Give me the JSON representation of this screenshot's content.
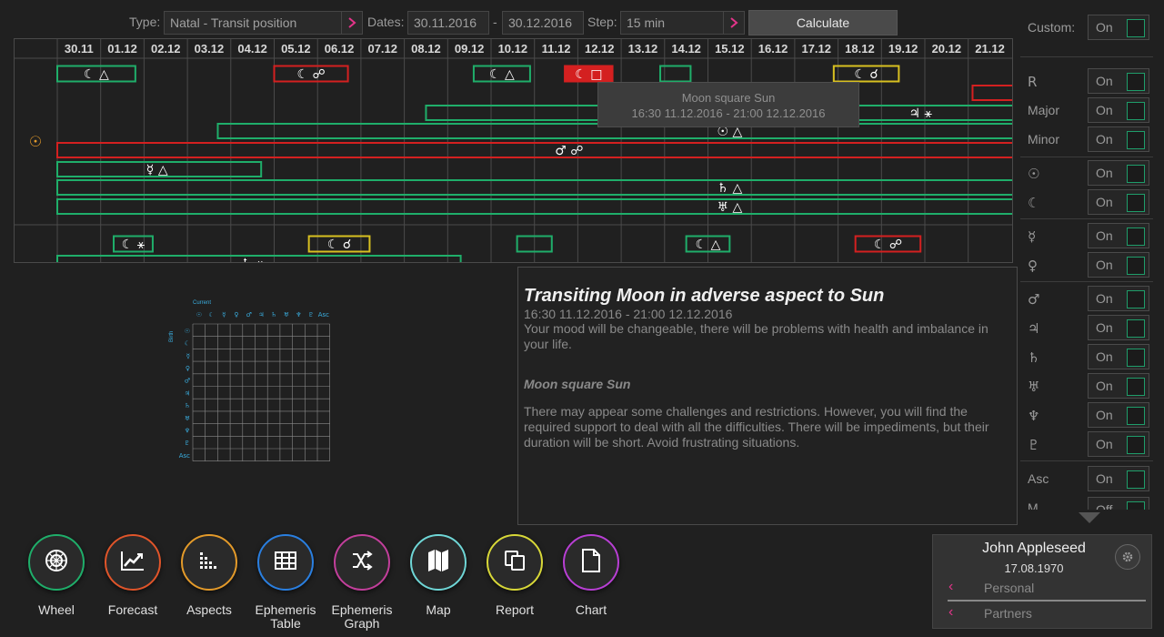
{
  "toolbar": {
    "type_label": "Type:",
    "type_value": "Natal - Transit position",
    "dates_label": "Dates:",
    "date_from": "30.11.2016",
    "date_sep": "-",
    "date_to": "30.12.2016",
    "step_label": "Step:",
    "step_value": "15 min",
    "calculate_label": "Calculate"
  },
  "grid": {
    "dates": [
      "30.11",
      "01.12",
      "02.12",
      "03.12",
      "04.12",
      "05.12",
      "06.12",
      "07.12",
      "08.12",
      "09.12",
      "10.12",
      "11.12",
      "12.12",
      "13.12",
      "14.12",
      "15.12",
      "16.12",
      "17.12",
      "18.12",
      "19.12",
      "20.12",
      "21.12"
    ],
    "natal_planet_glyph": "☉",
    "bars": [
      {
        "row": 0,
        "start": 0,
        "end": 1.8,
        "color": "green",
        "label": "☾ △"
      },
      {
        "row": 0,
        "start": 5.0,
        "end": 6.7,
        "color": "red",
        "label": "☾ ☍"
      },
      {
        "row": 0,
        "start": 9.6,
        "end": 10.9,
        "color": "green",
        "label": "☾ △"
      },
      {
        "row": 0,
        "start": 11.7,
        "end": 12.8,
        "color": "red-fill",
        "label": "☾ □"
      },
      {
        "row": 0,
        "start": 13.9,
        "end": 14.6,
        "color": "green",
        "label": ""
      },
      {
        "row": 0,
        "start": 17.9,
        "end": 19.4,
        "color": "yellow",
        "label": "☾ ☌"
      },
      {
        "row": 1,
        "start": 21.1,
        "end": 22.5,
        "color": "red",
        "label": ""
      },
      {
        "row": 2,
        "start": 8.5,
        "end": 22.5,
        "color": "green",
        "label": "♃ ⚹"
      },
      {
        "row": 3,
        "start": 3.7,
        "end": 22.5,
        "color": "green",
        "label": "☉ △"
      },
      {
        "row": 4,
        "start": 0,
        "end": 22.5,
        "color": "red",
        "label": "♂ ☍"
      },
      {
        "row": 5,
        "start": 0,
        "end": 4.7,
        "color": "green",
        "label": "☿ △"
      },
      {
        "row": 6,
        "start": 0,
        "end": 22.5,
        "color": "green",
        "label": "♄ △"
      },
      {
        "row": 7,
        "start": 0,
        "end": 22.5,
        "color": "green",
        "label": "♅ △"
      },
      {
        "row": 8,
        "start": 1.3,
        "end": 2.2,
        "color": "green",
        "label": "☾ ⚹"
      },
      {
        "row": 8,
        "start": 5.8,
        "end": 7.2,
        "color": "yellow",
        "label": "☾ ☌"
      },
      {
        "row": 8,
        "start": 10.6,
        "end": 11.4,
        "color": "green",
        "label": ""
      },
      {
        "row": 8,
        "start": 14.5,
        "end": 15.5,
        "color": "green",
        "label": "☾ △"
      },
      {
        "row": 8,
        "start": 18.4,
        "end": 19.9,
        "color": "red",
        "label": "☾ ☍"
      },
      {
        "row": 9,
        "start": 0,
        "end": 9.3,
        "color": "green",
        "label": "♄ ⚹"
      }
    ]
  },
  "tooltip": {
    "title": "Moon square Sun",
    "range": "16:30 11.12.2016 - 21:00 12.12.2016"
  },
  "right_panel": {
    "rows": [
      {
        "label": "Custom:",
        "value": "On"
      },
      {
        "label": "R",
        "value": "On"
      },
      {
        "label": "Major",
        "value": "On"
      },
      {
        "label": "Minor",
        "value": "On"
      },
      {
        "label": "☉",
        "value": "On"
      },
      {
        "label": "☾",
        "value": "On"
      },
      {
        "label": "☿",
        "value": "On"
      },
      {
        "label": "♀",
        "value": "On"
      },
      {
        "label": "♂",
        "value": "On"
      },
      {
        "label": "♃",
        "value": "On"
      },
      {
        "label": "♄",
        "value": "On"
      },
      {
        "label": "♅",
        "value": "On"
      },
      {
        "label": "♆",
        "value": "On"
      },
      {
        "label": "♇",
        "value": "On"
      },
      {
        "label": "Asc",
        "value": "On"
      },
      {
        "label": "M",
        "value": "Off"
      }
    ]
  },
  "matrix": {
    "title": "Current",
    "side_title": "Birth",
    "glyphs": [
      "☉",
      "☾",
      "☿",
      "♀",
      "♂",
      "♃",
      "♄",
      "♅",
      "♆",
      "♇",
      "Asc"
    ]
  },
  "text_panel": {
    "title": "Transiting Moon in adverse aspect to Sun",
    "range": "16:30 11.12.2016 - 21:00 12.12.2016",
    "paragraph1": "Your mood will be changeable, there will be problems with health and imbalance in your life.",
    "subtitle": "Moon square Sun",
    "paragraph2": "There may appear some challenges and restrictions. However, you will find the required support to deal with all the difficulties. There will be impediments, but their duration will be short. Avoid frustrating situations."
  },
  "nav": [
    {
      "label": "Wheel",
      "color": "#1fae6a",
      "icon": "wheel-icon"
    },
    {
      "label": "Forecast",
      "color": "#e0552a",
      "icon": "forecast-icon"
    },
    {
      "label": "Aspects",
      "color": "#e39a2a",
      "icon": "aspects-icon"
    },
    {
      "label": "Ephemeris Table",
      "color": "#2a7fe0",
      "icon": "table-icon"
    },
    {
      "label": "Ephemeris Graph",
      "color": "#c23f9b",
      "icon": "graph-icon"
    },
    {
      "label": "Map",
      "color": "#6fd6d6",
      "icon": "map-icon"
    },
    {
      "label": "Report",
      "color": "#d8d838",
      "icon": "report-icon"
    },
    {
      "label": "Chart",
      "color": "#b83fd4",
      "icon": "chart-icon"
    }
  ],
  "profile": {
    "name": "John Appleseed",
    "date": "17.08.1970",
    "personal_label": "Personal",
    "partners_label": "Partners"
  }
}
